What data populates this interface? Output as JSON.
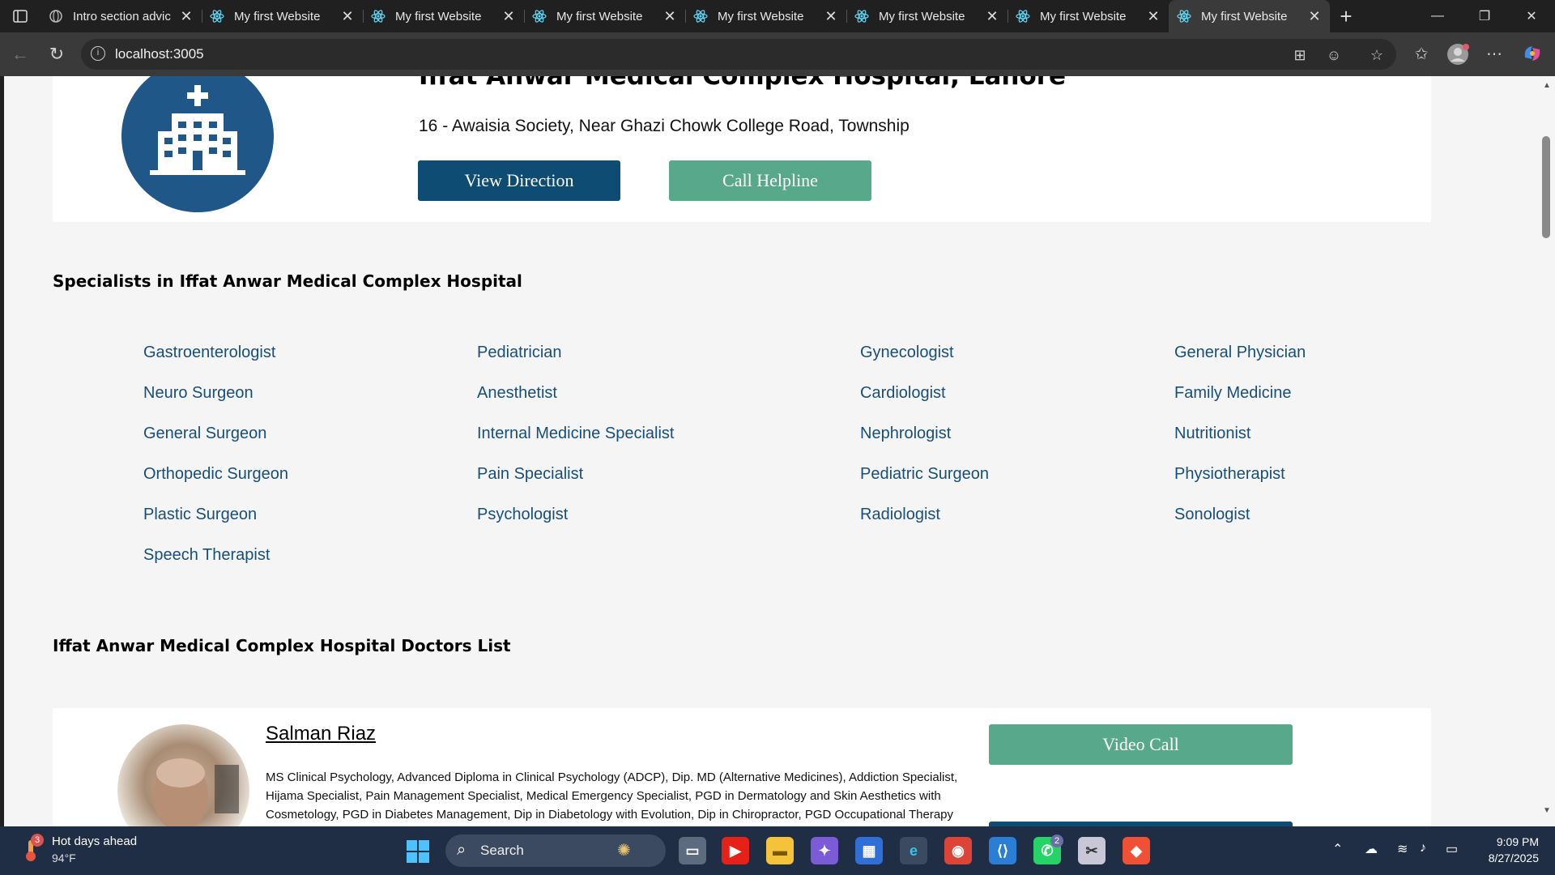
{
  "browser": {
    "tabs": [
      {
        "title": "Intro section advic",
        "icon": "globe-icon",
        "active": false
      },
      {
        "title": "My first Website",
        "icon": "react-icon",
        "active": false
      },
      {
        "title": "My first Website",
        "icon": "react-icon",
        "active": false
      },
      {
        "title": "My first Website",
        "icon": "react-icon",
        "active": false
      },
      {
        "title": "My first Website",
        "icon": "react-icon",
        "active": false
      },
      {
        "title": "My first Website",
        "icon": "react-icon",
        "active": false
      },
      {
        "title": "My first Website",
        "icon": "react-icon",
        "active": false
      },
      {
        "title": "My first Website",
        "icon": "react-icon",
        "active": true
      }
    ],
    "url": "localhost:3005"
  },
  "hospital": {
    "name": "Iffat Anwar Medical Complex Hospital, Lahore",
    "address": "16 - Awaisia Society, Near Ghazi Chowk College Road, Township",
    "view_direction_label": "View Direction",
    "call_helpline_label": "Call Helpline"
  },
  "specialists": {
    "heading": "Specialists in Iffat Anwar Medical Complex Hospital",
    "items": [
      "Gastroenterologist",
      "Pediatrician",
      "Gynecologist",
      "General Physician",
      "Neuro Surgeon",
      "Anesthetist",
      "Cardiologist",
      "Family Medicine",
      "General Surgeon",
      "Internal Medicine Specialist",
      "Nephrologist",
      "Nutritionist",
      "Orthopedic Surgeon",
      "Pain Specialist",
      "Pediatric Surgeon",
      "Physiotherapist",
      "Plastic Surgeon",
      "Psychologist",
      "Radiologist",
      "Sonologist",
      "Speech Therapist"
    ]
  },
  "doctors": {
    "heading": "Iffat Anwar Medical Complex Hospital Doctors List",
    "list": [
      {
        "name": "Salman Riaz",
        "qualifications": "MS Clinical Psychology, Advanced Diploma in Clinical Psychology (ADCP), Dip. MD (Alternative Medicines), Addiction Specialist, Hijama Specialist, Pain Management Specialist, Medical Emergency Specialist, PGD in Dermatology and Skin Aesthetics with Cosmetology, PGD in Diabetes Management, Dip in Diabetology with Evolution, Dip in Chiropractor, PGD Occupational Therapy",
        "video_call_label": "Video Call"
      }
    ]
  },
  "taskbar": {
    "weather_title": "Hot days ahead",
    "weather_temp": "94°F",
    "weather_badge": "3",
    "search_label": "Search",
    "whatsapp_badge": "2",
    "time": "9:09 PM",
    "date": "8/27/2025"
  },
  "colors": {
    "primary_button": "#0f4c73",
    "secondary_button": "#58a88c",
    "specialist_link": "#174f7a",
    "hospital_logo_bg": "#1f5788"
  }
}
